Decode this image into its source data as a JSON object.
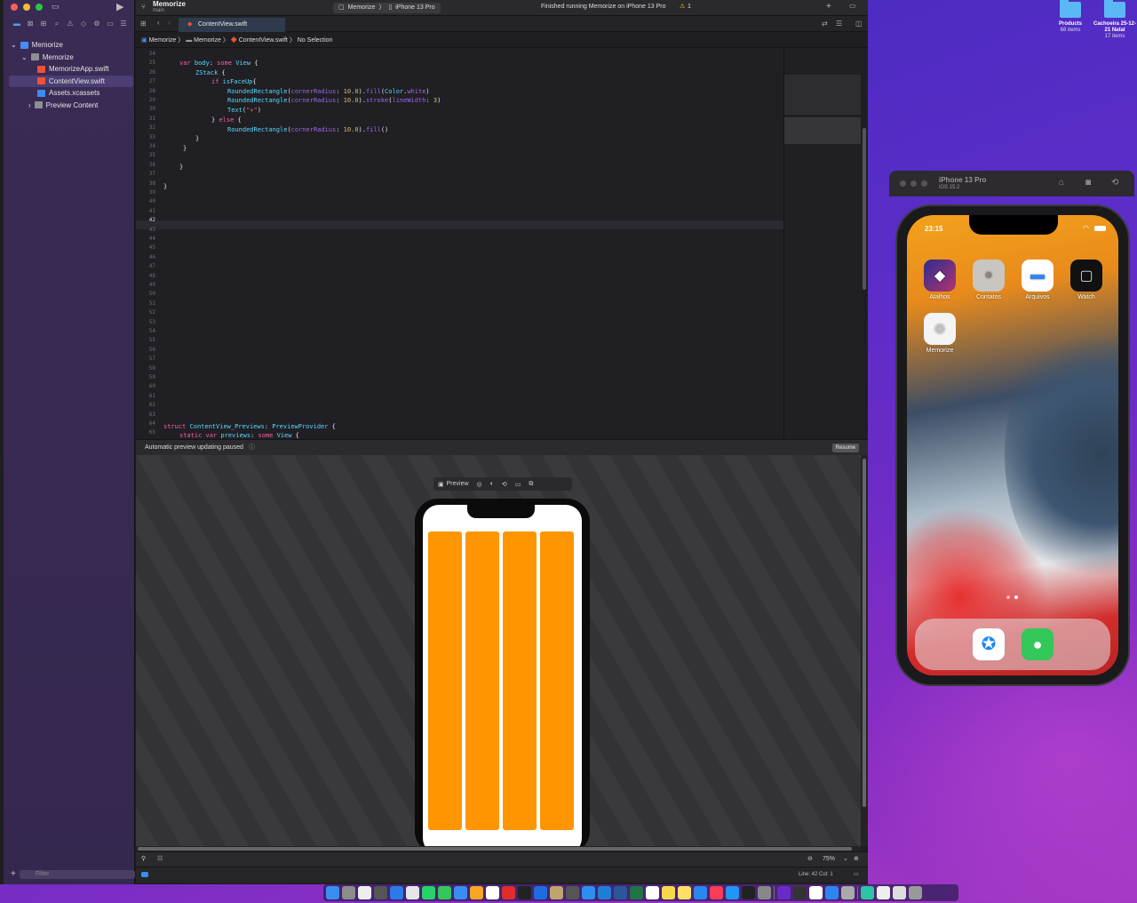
{
  "xcode": {
    "scheme_project": "Memorize",
    "branch": "main",
    "scheme_target": "Memorize",
    "device": "iPhone 13 Pro",
    "status_text": "Finished running Memorize on iPhone 13 Pro",
    "warning_count": "1",
    "navigator": {
      "filter_placeholder": "Filter",
      "items": [
        {
          "label": "Memorize",
          "level": 0
        },
        {
          "label": "Memorize",
          "level": 1
        },
        {
          "label": "MemorizeApp.swift",
          "level": 2
        },
        {
          "label": "ContentView.swift",
          "level": 2
        },
        {
          "label": "Assets.xcassets",
          "level": 2
        },
        {
          "label": "Preview Content",
          "level": 2
        }
      ]
    },
    "tab_label": "ContentView.swift",
    "jumpbar": {
      "project": "Memorize",
      "group": "Memorize",
      "file": "ContentView.swift",
      "selection": "No Selection"
    },
    "line_numbers": [
      "24",
      "25",
      "26",
      "27",
      "28",
      "29",
      "30",
      "31",
      "32",
      "33",
      "34",
      "35",
      "36",
      "37",
      "38",
      "39",
      "40",
      "41",
      "42",
      "43",
      "44",
      "45",
      "46",
      "47",
      "48",
      "49",
      "50",
      "51",
      "52",
      "53",
      "54",
      "55",
      "56",
      "57",
      "58",
      "59",
      "60",
      "61",
      "62",
      "63",
      "64",
      "65"
    ],
    "code_bottom": "struct ContentView_Previews: PreviewProvider {",
    "code_bottom2": "static var previews: some View {",
    "preview": {
      "paused_text": "Automatic preview updating paused",
      "resume_label": "Resume",
      "toolbar_label": "Preview",
      "zoom": "75%"
    },
    "status": {
      "cursor": "Line: 42  Col: 1"
    }
  },
  "simulator": {
    "device_name": "iPhone 13 Pro",
    "os": "iOS 15.2",
    "time": "23:15",
    "apps": [
      "Atalhos",
      "Contatos",
      "Arquivos",
      "Watch",
      "Memorize"
    ]
  },
  "desktop": {
    "icons": [
      {
        "name": "Products",
        "sub": "68 items"
      },
      {
        "name": "Cachoeira 25-12-21 Natal",
        "sub": "17 items"
      }
    ]
  },
  "colors": {
    "card": "#ff9500",
    "keyword": "#fc5fa3",
    "type": "#5dd8ff"
  }
}
